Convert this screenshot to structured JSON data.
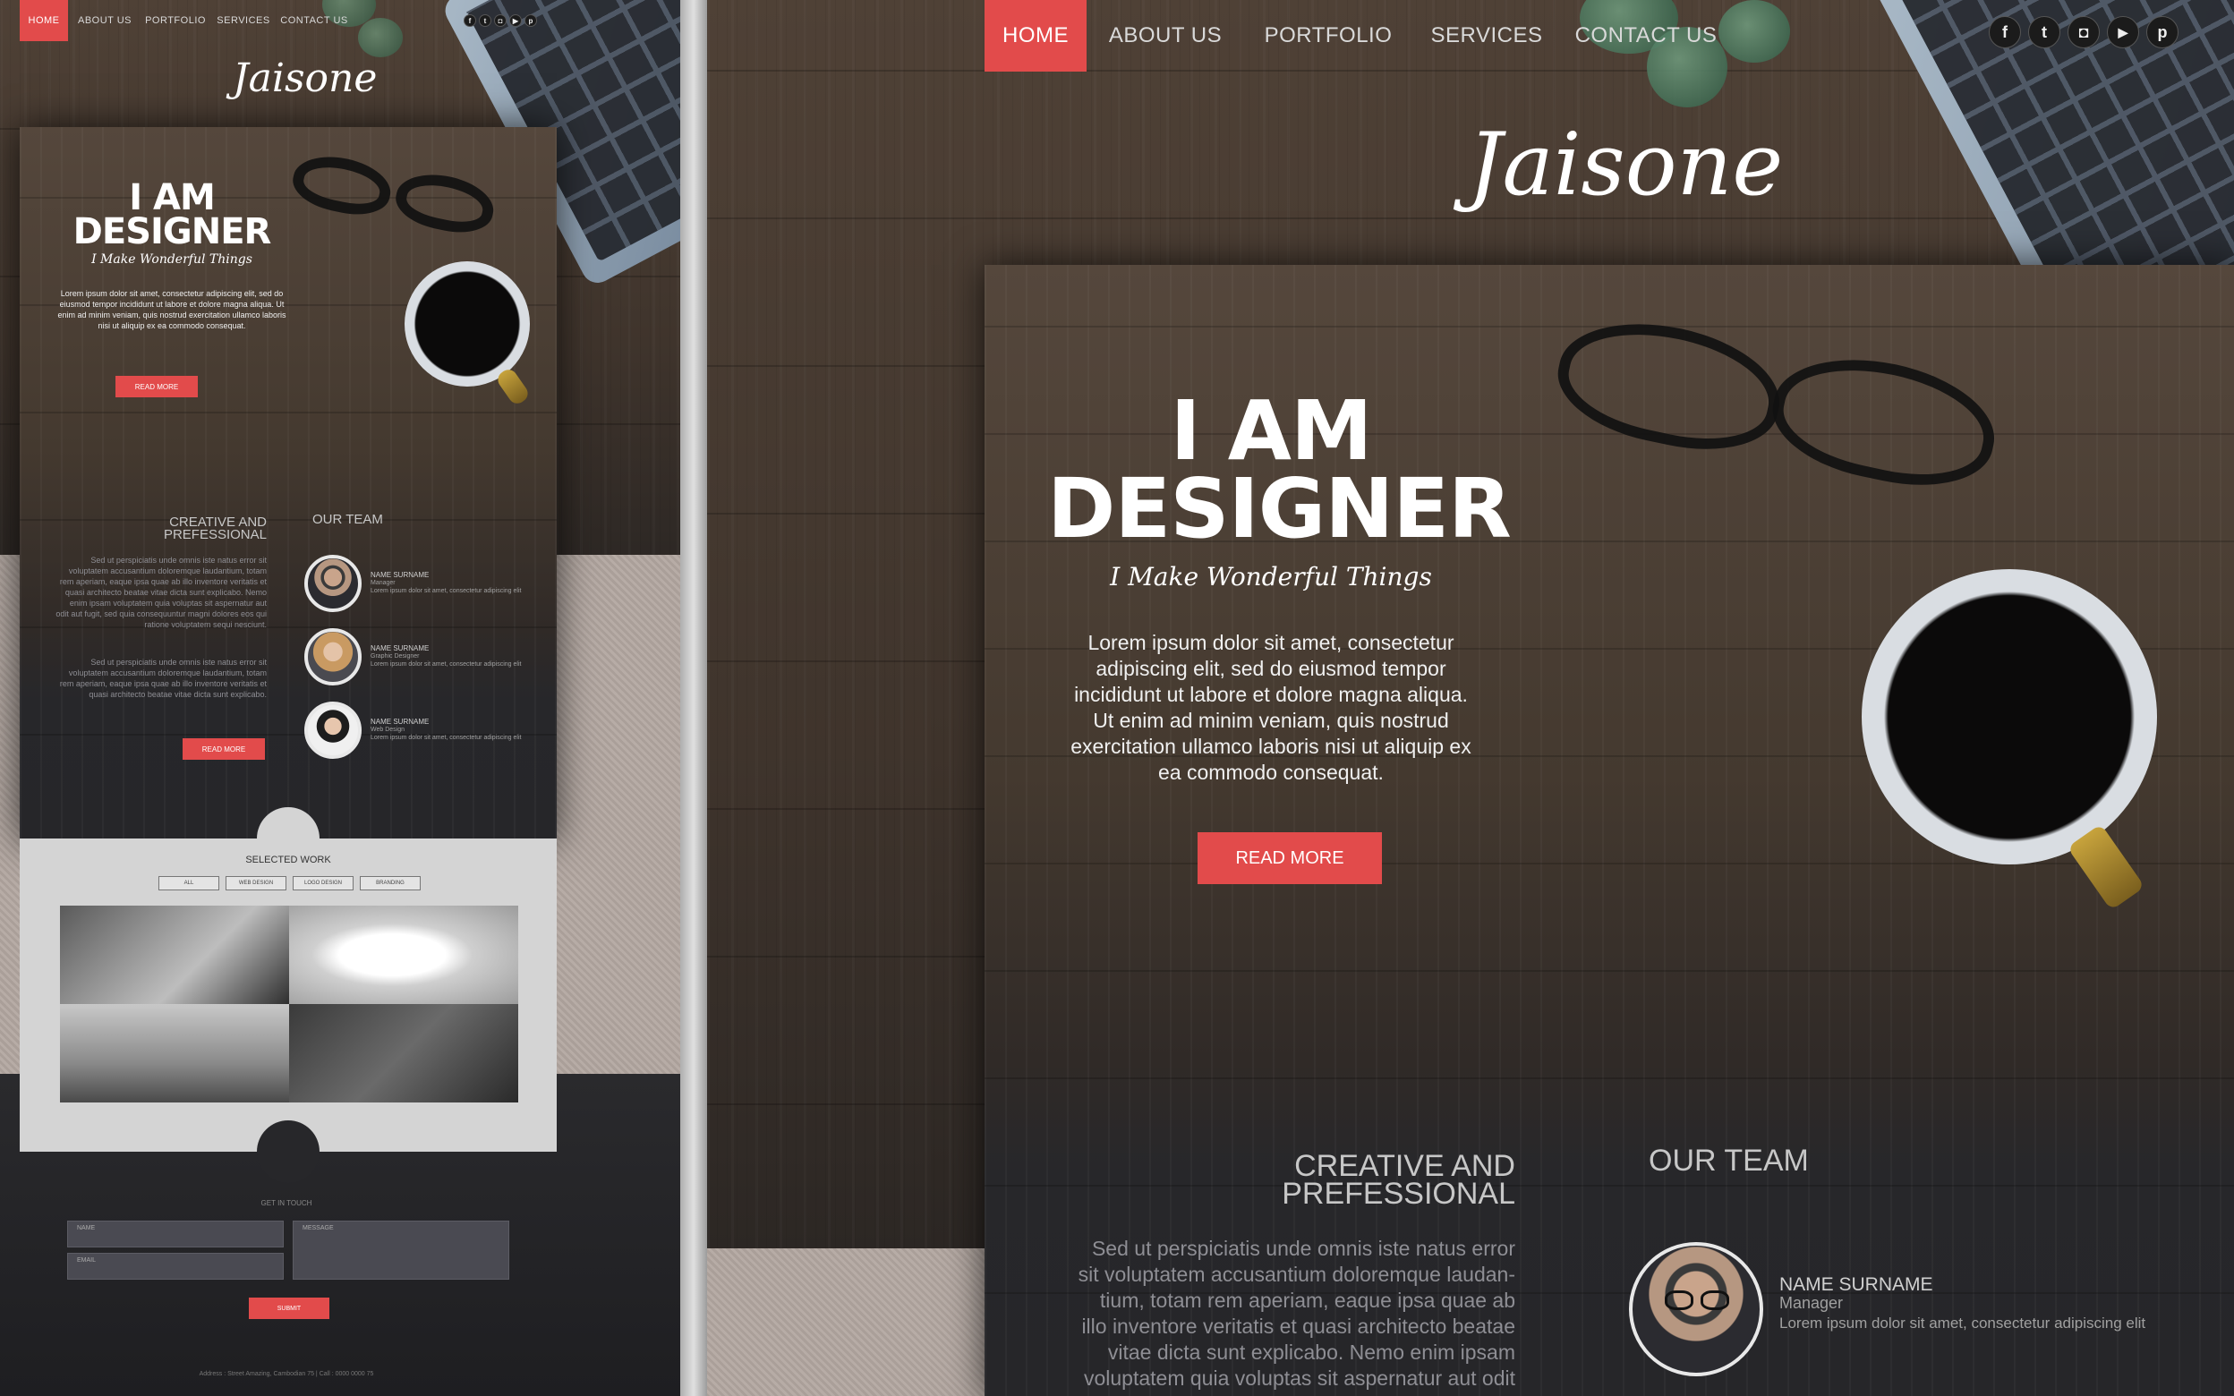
{
  "nav": {
    "items": [
      {
        "label": "HOME",
        "active": true
      },
      {
        "label": "ABOUT US",
        "active": false
      },
      {
        "label": "PORTFOLIO",
        "active": false
      },
      {
        "label": "SERVICES",
        "active": false
      },
      {
        "label": "CONTACT US",
        "active": false
      }
    ],
    "accent": "#e24b4b"
  },
  "social": [
    {
      "icon": "facebook-icon",
      "glyph": "f"
    },
    {
      "icon": "twitter-icon",
      "glyph": "t"
    },
    {
      "icon": "instagram-icon",
      "glyph": "◘"
    },
    {
      "icon": "youtube-icon",
      "glyph": "▶"
    },
    {
      "icon": "pinterest-icon",
      "glyph": "p"
    }
  ],
  "logo": "Jaisone",
  "hero": {
    "title_line1": "I AM",
    "title_line2": "DESIGNER",
    "tagline": "I Make Wonderful Things",
    "body": "Lorem ipsum dolor sit amet, consectetur adipiscing elit, sed do eiusmod tempor incididunt ut labore et dolore magna aliqua. Ut enim ad minim veniam, quis nostrud exercitation ullamco laboris nisi ut aliquip ex ea commodo consequat.",
    "button": "READ MORE"
  },
  "about": {
    "heading_line1": "CREATIVE AND",
    "heading_line2": "PREFESSIONAL",
    "body_full": "Sed ut perspiciatis unde omnis iste natus error sit voluptatem accusantium doloremque laudantium, totam rem aperiam, eaque ipsa quae ab illo inventore veritatis et quasi architecto beatae vitae dicta sunt explicabo. Nemo enim ipsam voluptatem quia voluptas sit aspernatur aut odit aut fugit, sed quia consequuntur magni dolores eos qui ratione voluptatem sequi nesciunt.",
    "body_second": "Sed ut perspiciatis unde omnis iste natus error sit voluptatem accusantium doloremque laudantium, totam rem aperiam, eaque ipsa quae ab illo inventore veritatis et quasi architecto beatae vitae dicta sunt explicabo.",
    "body_right_l1": "Sed ut perspiciatis unde omnis iste natus error",
    "body_right_l2": "sit voluptatem accusantium doloremque laudan-",
    "body_right_l3": "tium, totam rem aperiam, eaque ipsa quae ab",
    "body_right_l4": "illo inventore veritatis et quasi architecto beatae",
    "body_right_l5": "vitae dicta sunt explicabo. Nemo enim ipsam",
    "body_right_l6": "voluptatem quia voluptas sit aspernatur aut odit",
    "button": "READ MORE"
  },
  "team": {
    "heading": "OUR TEAM",
    "members": [
      {
        "name": "NAME SURNAME",
        "role": "Manager",
        "desc": "Lorem ipsum dolor sit amet, consectetur adipiscing elit"
      },
      {
        "name": "NAME SURNAME",
        "role": "Graphic Designer",
        "desc": "Lorem ipsum dolor sit amet, consectetur adipiscing elit"
      },
      {
        "name": "NAME SURNAME",
        "role": "Web Design",
        "desc": "Lorem ipsum dolor sit amet, consectetur adipiscing elit"
      }
    ]
  },
  "work": {
    "heading": "SELECTED WORK",
    "filters": [
      "ALL",
      "WEB DESIGN",
      "LOGO DESIGN",
      "BRANDING"
    ]
  },
  "contact": {
    "heading": "GET IN TOUCH",
    "name_placeholder": "NAME",
    "email_placeholder": "EMAIL",
    "message_placeholder": "MESSAGE",
    "submit": "SUBMIT"
  },
  "footer": "Address : Street Amazing, Cambodian 75   |   Call : 0000 0000 75"
}
